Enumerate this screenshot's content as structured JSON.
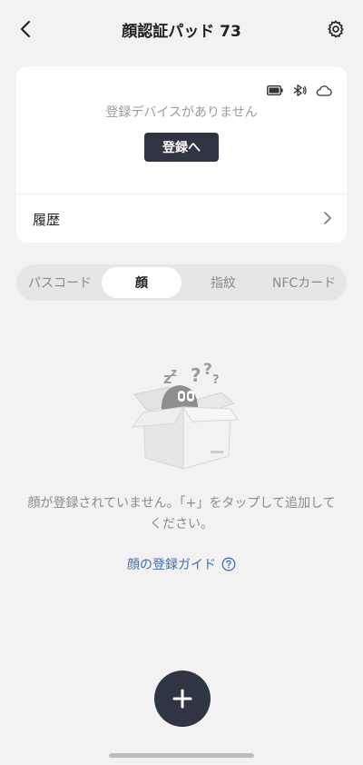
{
  "header": {
    "title": "顔認証パッド 73",
    "back_icon": "chevron-left-icon",
    "settings_icon": "gear-icon"
  },
  "device_card": {
    "status_icons": [
      "battery-icon",
      "bluetooth-icon",
      "cloud-icon"
    ],
    "no_device_text": "登録デバイスがありません",
    "register_button": "登録へ",
    "history_label": "履歴"
  },
  "tabs": [
    {
      "label": "パスコード",
      "active": false
    },
    {
      "label": "顔",
      "active": true
    },
    {
      "label": "指紋",
      "active": false
    },
    {
      "label": "NFCカード",
      "active": false
    }
  ],
  "empty_state": {
    "illustration": "empty-box-icon",
    "message": "顔が登録されていません。「+」をタップして追加してください。",
    "guide_link": "顔の登録ガイド",
    "guide_icon": "help-circle-icon"
  },
  "add_button_icon": "plus-icon",
  "colors": {
    "background": "#f2f2f2",
    "primary_dark": "#2f3542",
    "link": "#3f6db3",
    "muted_text": "#8a8a8a"
  }
}
